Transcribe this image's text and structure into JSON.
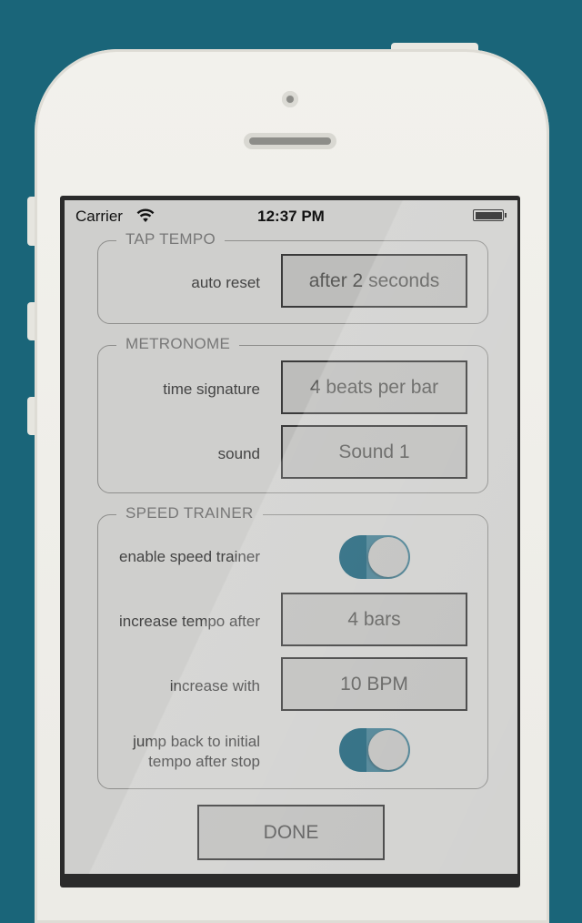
{
  "status": {
    "carrier": "Carrier",
    "time": "12:37 PM"
  },
  "tap_tempo": {
    "title": "TAP TEMPO",
    "auto_reset_label": "auto reset",
    "auto_reset_value": "after 2 seconds"
  },
  "metronome": {
    "title": "METRONOME",
    "time_signature_label": "time signature",
    "time_signature_value": "4 beats per bar",
    "sound_label": "sound",
    "sound_value": "Sound 1"
  },
  "speed_trainer": {
    "title": "SPEED TRAINER",
    "enable_label": "enable speed trainer",
    "enable_on": true,
    "increase_after_label": "increase tempo after",
    "increase_after_value": "4 bars",
    "increase_with_label": "increase with",
    "increase_with_value": "10 BPM",
    "jump_back_label_line1": "jump back to initial",
    "jump_back_label_line2": "tempo after stop",
    "jump_back_on": true
  },
  "done_label": "DONE",
  "colors": {
    "background": "#1a6579",
    "toggle_on": "#1d6178",
    "screen": "#cfcfcd"
  }
}
